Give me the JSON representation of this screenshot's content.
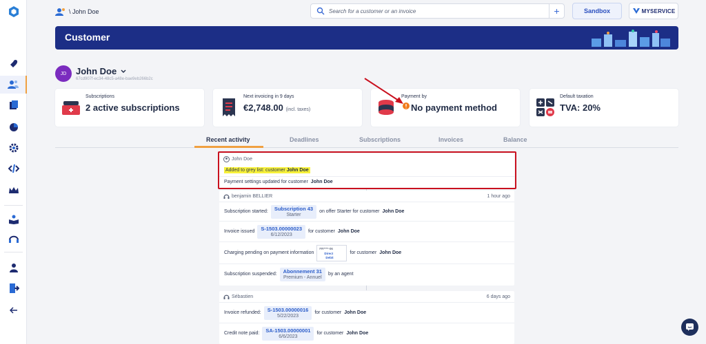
{
  "topbar": {
    "breadcrumb": "\\ John Doe",
    "search_placeholder": "Search for a customer or an invoice",
    "add": "+",
    "sandbox": "Sandbox",
    "brand": "MYSERVICE"
  },
  "banner": {
    "title": "Customer"
  },
  "customer": {
    "initials": "JD",
    "name": "John Doe",
    "id": "67cd907f-ec34-48c5-a48e-bae9eb266b2c"
  },
  "cards": [
    {
      "label": "Subscriptions",
      "value": "2 active subscriptions",
      "suffix": ""
    },
    {
      "label": "Next invoicing in 9 days",
      "value": "€2,748.00",
      "suffix": "(incl. taxes)"
    },
    {
      "label": "Payment by",
      "value": "No payment method",
      "suffix": ""
    },
    {
      "label": "Default taxation",
      "value": "TVA: 20%",
      "suffix": ""
    }
  ],
  "tabs": [
    "Recent activity",
    "Deadlines",
    "Subscriptions",
    "Invoices",
    "Balance"
  ],
  "activity": {
    "group1": {
      "author": "John Doe",
      "row1_text": "Added to grey list: customer",
      "row1_bold": "John Doe",
      "row2_text": "Payment settings updated for customer",
      "row2_bold": "John Doe"
    },
    "group2": {
      "author": "benjamin BELLIER",
      "ago": "1 hour ago",
      "r1_pre": "Subscription started:",
      "r1_chip1": "Subscription 43",
      "r1_chip2": "Starter",
      "r1_post": "on offer Starter for customer",
      "r1_bold": "John Doe",
      "r2_pre": "Invoice issued",
      "r2_chip1": "S-1503.00000023",
      "r2_chip2": "6/12/2023",
      "r2_post": "for customer",
      "r2_bold": "John Doe",
      "r3_pre": "Charging pending on payment information",
      "r3_img1": "FR****-06",
      "r3_img2": "Direct",
      "r3_img3": "Debit",
      "r3_post": "for customer",
      "r3_bold": "John Doe",
      "r4_pre": "Subscription suspended:",
      "r4_chip1": "Abonnement 31",
      "r4_chip2": "Premium - Annuel",
      "r4_post": "by an agent"
    },
    "group3": {
      "author": "Sébastien",
      "ago": "6 days ago",
      "r1_pre": "Invoice refunded:",
      "r1_chip1": "S-1503.00000016",
      "r1_chip2": "5/22/2023",
      "r1_post": "for customer",
      "r1_bold": "John Doe",
      "r2_pre": "Credit note paid:",
      "r2_chip1": "SA-1503.00000001",
      "r2_chip2": "6/6/2023",
      "r2_post": "for customer",
      "r2_bold": "John Doe"
    }
  }
}
